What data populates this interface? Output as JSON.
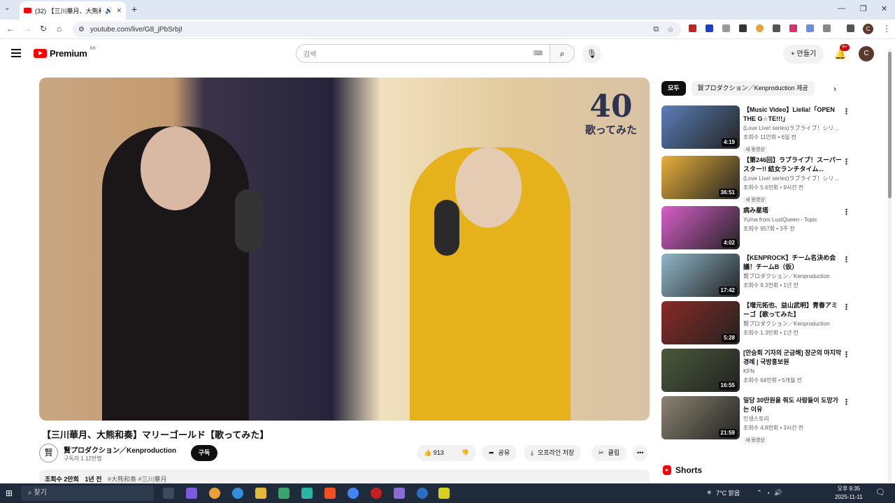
{
  "browser": {
    "tab_title": "(32) 【三川華月、大熊和奏】",
    "url": "youtube.com/live/G8_jPbSrbjI"
  },
  "header": {
    "logo_text": "Premium",
    "logo_region": "KR",
    "search_placeholder": "검색",
    "create_label": "만들기",
    "notif_badge": "9+",
    "avatar_letter": "C"
  },
  "video": {
    "overlay_number": "40",
    "overlay_sub": "歌ってみた",
    "title": "【三川華月、大熊和奏】マリーゴールド【歌ってみた】",
    "channel": "賢プロダクション／Kenproduction",
    "subscribers": "구독자 1.12만명",
    "subscribe_label": "구독",
    "likes": "913",
    "share_label": "공유",
    "offline_label": "오프라인 저장",
    "clip_label": "클립",
    "views": "조회수 2만회",
    "age": "1년 전",
    "hashtags": "#大熊和奏 #三川華月"
  },
  "chips": [
    "모두",
    "賢プロダクション／Kenproduction 제공"
  ],
  "recommendations": [
    {
      "title": "【Music Video】Liella!「OPEN THE G☆TE!!!」",
      "channel": "(Love Live! series)ラブライブ！シリーズ...",
      "meta": "조회수 11만회 • 6일 전",
      "badge": "새 동영상",
      "duration": "4:19",
      "color": "#5b7fb8"
    },
    {
      "title": "【第246回】ラブライブ！スーパースター!! 結女ランチタイム...",
      "channel": "(Love Live! series)ラブライブ！シリーズ...",
      "meta": "조회수 5.6천회 • 9시간 전",
      "badge": "새 동영상",
      "duration": "36:51",
      "color": "#e8b03a"
    },
    {
      "title": "病み星塔",
      "channel": "Yu!na from LustQueen - Topic",
      "meta": "조회수 957회 • 3주 전",
      "badge": "",
      "duration": "4:02",
      "color": "#d85ec9"
    },
    {
      "title": "【KENPROCK】チーム名決め会議！チームB（仮）",
      "channel": "賢プロダクション／Kenproduction",
      "meta": "조회수 9.3천회 • 1년 전",
      "badge": "",
      "duration": "17:42",
      "color": "#8fb7c9"
    },
    {
      "title": "【増元拓也、益山武明】青春アミーゴ【歌ってみた】",
      "channel": "賢プロダクション／Kenproduction",
      "meta": "조회수 1.3만회 • 1년 전",
      "badge": "",
      "duration": "5:28",
      "color": "#8a2a24"
    },
    {
      "title": "[안승회 기자의 군금해] 장군의 마지막 경례 | 국방홍보원",
      "channel": "KFN",
      "meta": "조회수 64만회 • 5개월 전",
      "badge": "",
      "duration": "16:55",
      "color": "#4a5a3a"
    },
    {
      "title": "일당 30만원을 줘도 사람들이 도망가는 이유",
      "channel": "인생스토리",
      "meta": "조회수 4.8천회 • 3시간 전",
      "badge": "새 동영상",
      "duration": "21:59",
      "color": "#8b8470"
    }
  ],
  "shorts_label": "Shorts",
  "taskbar": {
    "search_label": "찾기",
    "weather": "7°C 맑음",
    "time": "오후 9:35",
    "date": "2025-11-11"
  }
}
